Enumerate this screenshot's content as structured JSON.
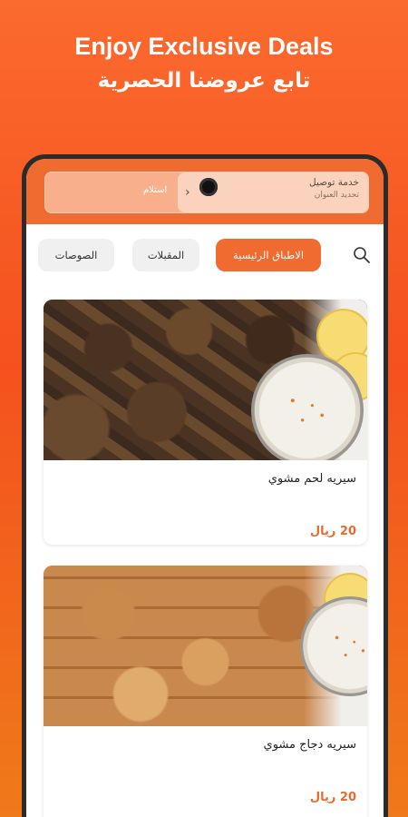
{
  "hero": {
    "title": "Enjoy Exclusive Deals",
    "subtitle": "تابع عروضنا الحصرية"
  },
  "order_mode": {
    "delivery_title": "خدمة توصيل",
    "delivery_sub": "تحديد العنوان",
    "pickup_label": "استلام"
  },
  "tabs": [
    {
      "label": "الاطباق الرئيسية",
      "active": true
    },
    {
      "label": "المقبلات",
      "active": false
    },
    {
      "label": "الصوصات",
      "active": false
    }
  ],
  "products": [
    {
      "name": "سيريه لحم مشوي",
      "price": "20 ريال"
    },
    {
      "name": "سيريه دجاج مشوي",
      "price": "20 ريال"
    }
  ],
  "colors": {
    "accent": "#f06b2f",
    "price": "#e86a2e"
  },
  "icons": {
    "search": "search-icon",
    "chevron": "chevron-left-icon"
  }
}
